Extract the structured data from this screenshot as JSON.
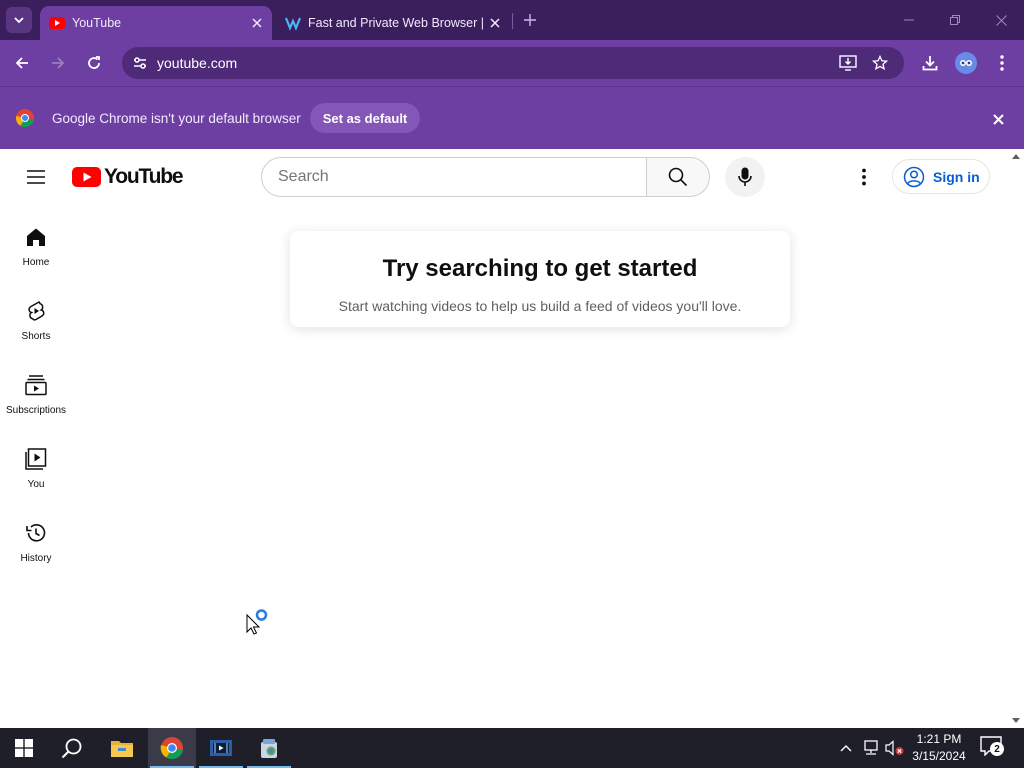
{
  "browser": {
    "tabs": [
      {
        "title": "YouTube",
        "active": true,
        "favicon": "youtube-icon"
      },
      {
        "title": "Fast and Private Web Browser |",
        "active": false,
        "favicon": "maxthon-icon"
      }
    ],
    "address": "youtube.com",
    "infobar": {
      "message": "Google Chrome isn't your default browser",
      "button_label": "Set as default"
    },
    "theme": {
      "tabstrip": "#3b1e5c",
      "toolbar": "#6e3fa2",
      "omnibox": "#4e2a78"
    }
  },
  "youtube": {
    "logo_text": "YouTube",
    "search": {
      "placeholder": "Search"
    },
    "signin_label": "Sign in",
    "guide": [
      {
        "label": "Home",
        "icon": "home-icon"
      },
      {
        "label": "Shorts",
        "icon": "shorts-icon"
      },
      {
        "label": "Subscriptions",
        "icon": "subscriptions-icon"
      },
      {
        "label": "You",
        "icon": "you-icon"
      },
      {
        "label": "History",
        "icon": "history-icon"
      }
    ],
    "empty_state": {
      "title": "Try searching to get started",
      "subtitle": "Start watching videos to help us build a feed of videos you'll love."
    },
    "brand_red": "#ff0000",
    "link_blue": "#065fd4"
  },
  "taskbar": {
    "apps": [
      "start-icon",
      "search-icon",
      "file-explorer-icon",
      "chrome-icon",
      "video-editor-icon",
      "installer-icon"
    ],
    "clock": {
      "time": "1:21 PM",
      "date": "3/15/2024"
    },
    "notifications": "2"
  }
}
